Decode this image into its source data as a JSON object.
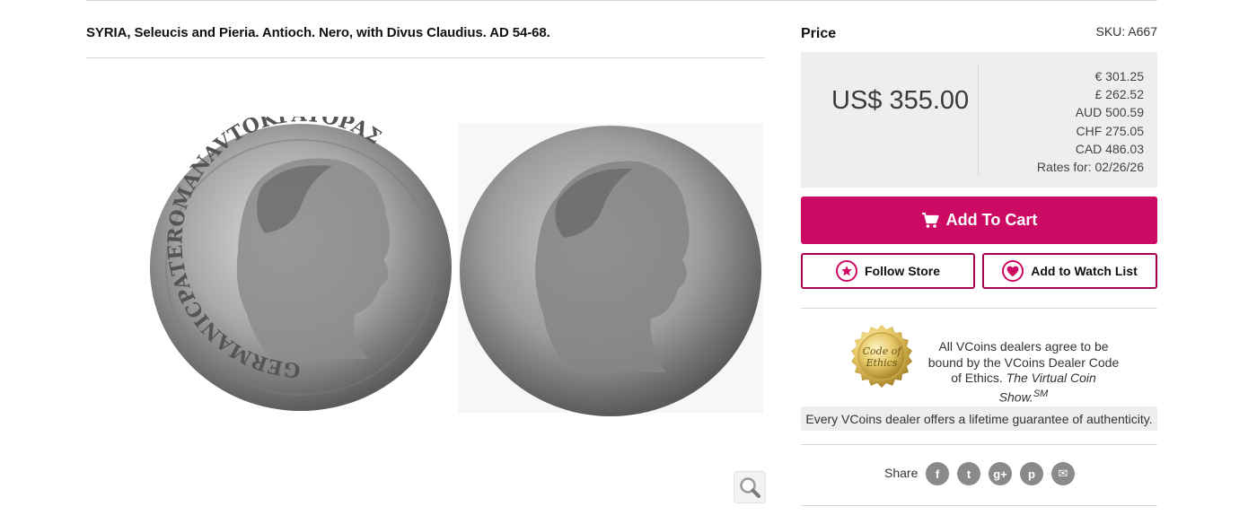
{
  "listing": {
    "title": "SYRIA, Seleucis and Pieria. Antioch. Nero, with Divus Claudius. AD 54-68.",
    "images": {
      "obverse_legend": "GERMANICPATEROMANAVTOKPATOPAΣ",
      "zoom_icon": "magnifier-icon"
    }
  },
  "pricing": {
    "label": "Price",
    "sku": "SKU: A667",
    "main_price": "US$ 355.00",
    "rates": [
      "€ 301.25",
      "£ 262.52",
      "AUD 500.59",
      "CHF 275.05",
      "CAD 486.03",
      "Rates for: 02/26/26"
    ]
  },
  "actions": {
    "add_to_cart": "Add To Cart",
    "follow_store": "Follow Store",
    "watch_list": "Add to Watch List",
    "cart_icon": "cart-icon",
    "star_icon": "star-icon",
    "heart_icon": "heart-icon",
    "accent_color": "#cd0a63"
  },
  "ethics": {
    "seal_line1": "Code of",
    "seal_line2": "Ethics",
    "text_plain": "All VCoins dealers agree to be bound by the VCoins Dealer Code of Ethics.",
    "text_italic": "The Virtual Coin Show.",
    "text_sup": "SM",
    "guarantee": "Every VCoins dealer offers a lifetime guarantee of authenticity."
  },
  "share": {
    "label": "Share",
    "icons": [
      {
        "name": "facebook-icon",
        "glyph": "f"
      },
      {
        "name": "twitter-icon",
        "glyph": "t"
      },
      {
        "name": "google-plus-icon",
        "glyph": "g+"
      },
      {
        "name": "pinterest-icon",
        "glyph": "p"
      },
      {
        "name": "email-icon",
        "glyph": "✉"
      }
    ]
  }
}
